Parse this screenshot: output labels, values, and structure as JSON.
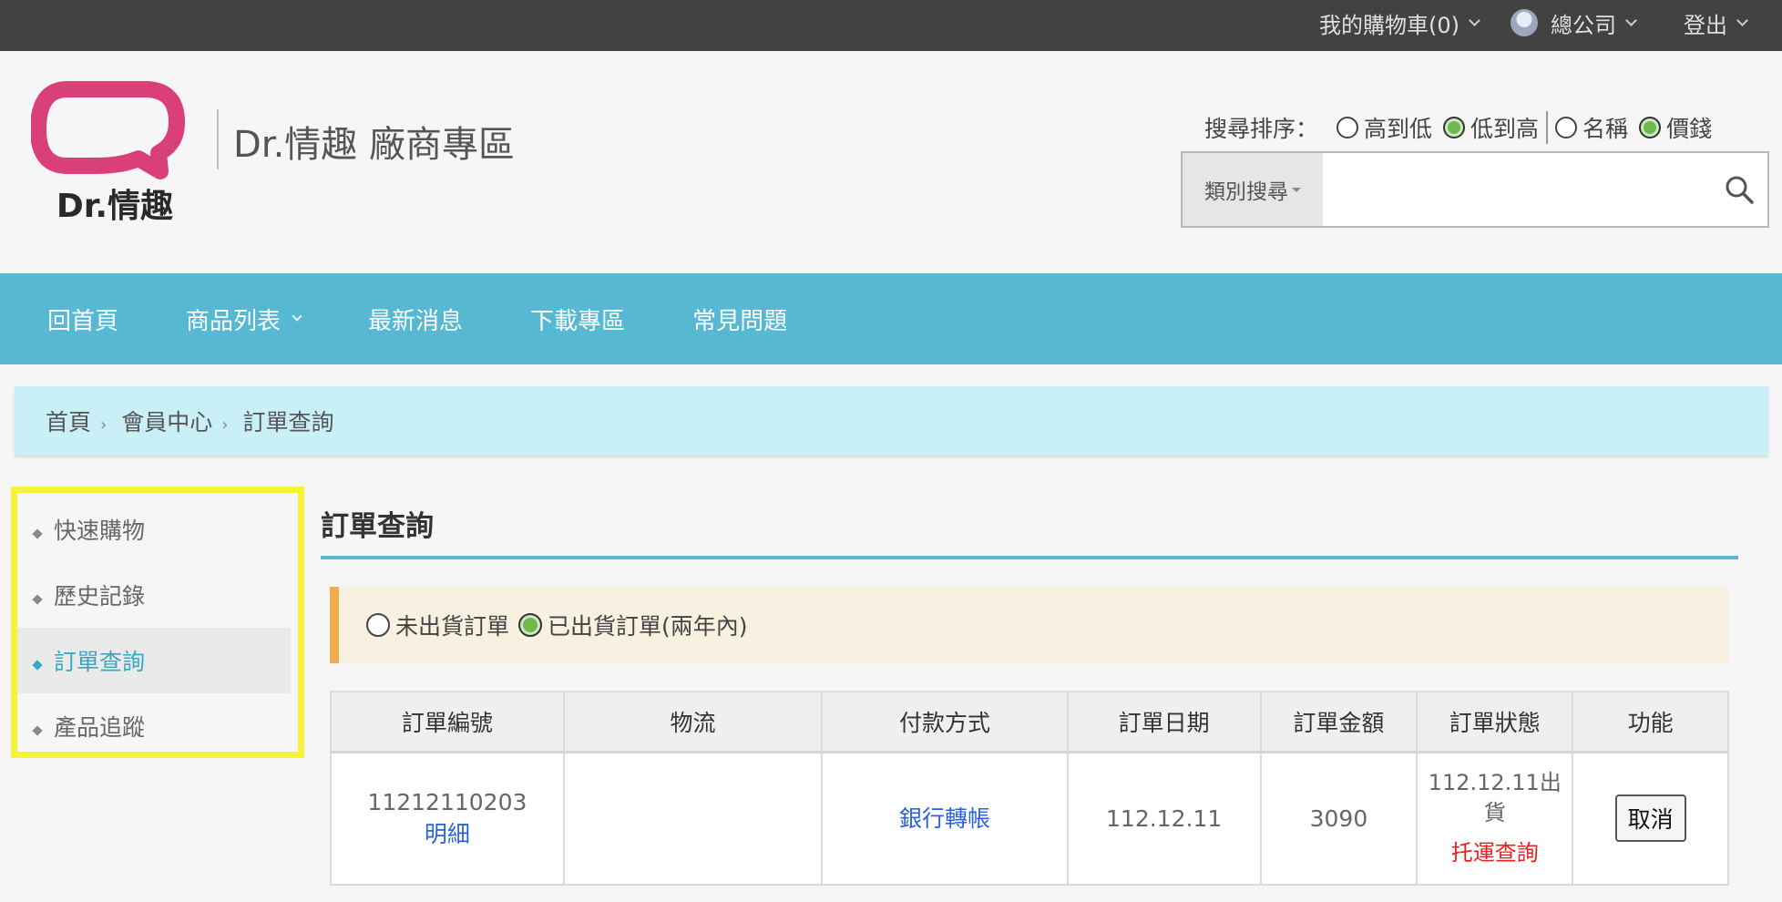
{
  "topbar": {
    "cart_label": "我的購物車(0)",
    "user_name": "總公司",
    "logout_label": "登出"
  },
  "header": {
    "logo_text": "Dr.情趣",
    "site_title": "Dr.情趣 廠商專區",
    "sort_label": "搜尋排序：",
    "sort_options": [
      {
        "label": "高到低",
        "checked": false
      },
      {
        "label": "低到高",
        "checked": true
      },
      {
        "label": "名稱",
        "checked": false
      },
      {
        "label": "價錢",
        "checked": true
      }
    ],
    "search_category_label": "類別搜尋",
    "search_value": ""
  },
  "nav": {
    "items": [
      "回首頁",
      "商品列表",
      "最新消息",
      "下載專區",
      "常見問題"
    ]
  },
  "breadcrumb": [
    "首頁",
    "會員中心",
    "訂單查詢"
  ],
  "sidebar": {
    "items": [
      "快速購物",
      "歷史記錄",
      "訂單查詢",
      "產品追蹤"
    ],
    "active_index": 2
  },
  "main": {
    "title": "訂單查詢",
    "filter_options": [
      {
        "label": "未出貨訂單",
        "checked": false
      },
      {
        "label": "已出貨訂單(兩年內)",
        "checked": true
      }
    ],
    "table": {
      "headers": [
        "訂單編號",
        "物流",
        "付款方式",
        "訂單日期",
        "訂單金額",
        "訂單狀態",
        "功能"
      ],
      "rows": [
        {
          "order_no": "11212110203",
          "detail_label": "明細",
          "logistics": "",
          "payment": "銀行轉帳",
          "date": "112.12.11",
          "amount": "3090",
          "status": "112.12.11出貨",
          "tracking_label": "托運查詢",
          "action_label": "取消"
        }
      ]
    }
  },
  "colors": {
    "topbar": "#424242",
    "nav": "#56b8d3",
    "breadcrumb_bg": "#c9eff7",
    "sidebar_highlight": "#f5f23a",
    "accent_orange": "#f0ad4e",
    "logo_pink": "#d9407a"
  }
}
